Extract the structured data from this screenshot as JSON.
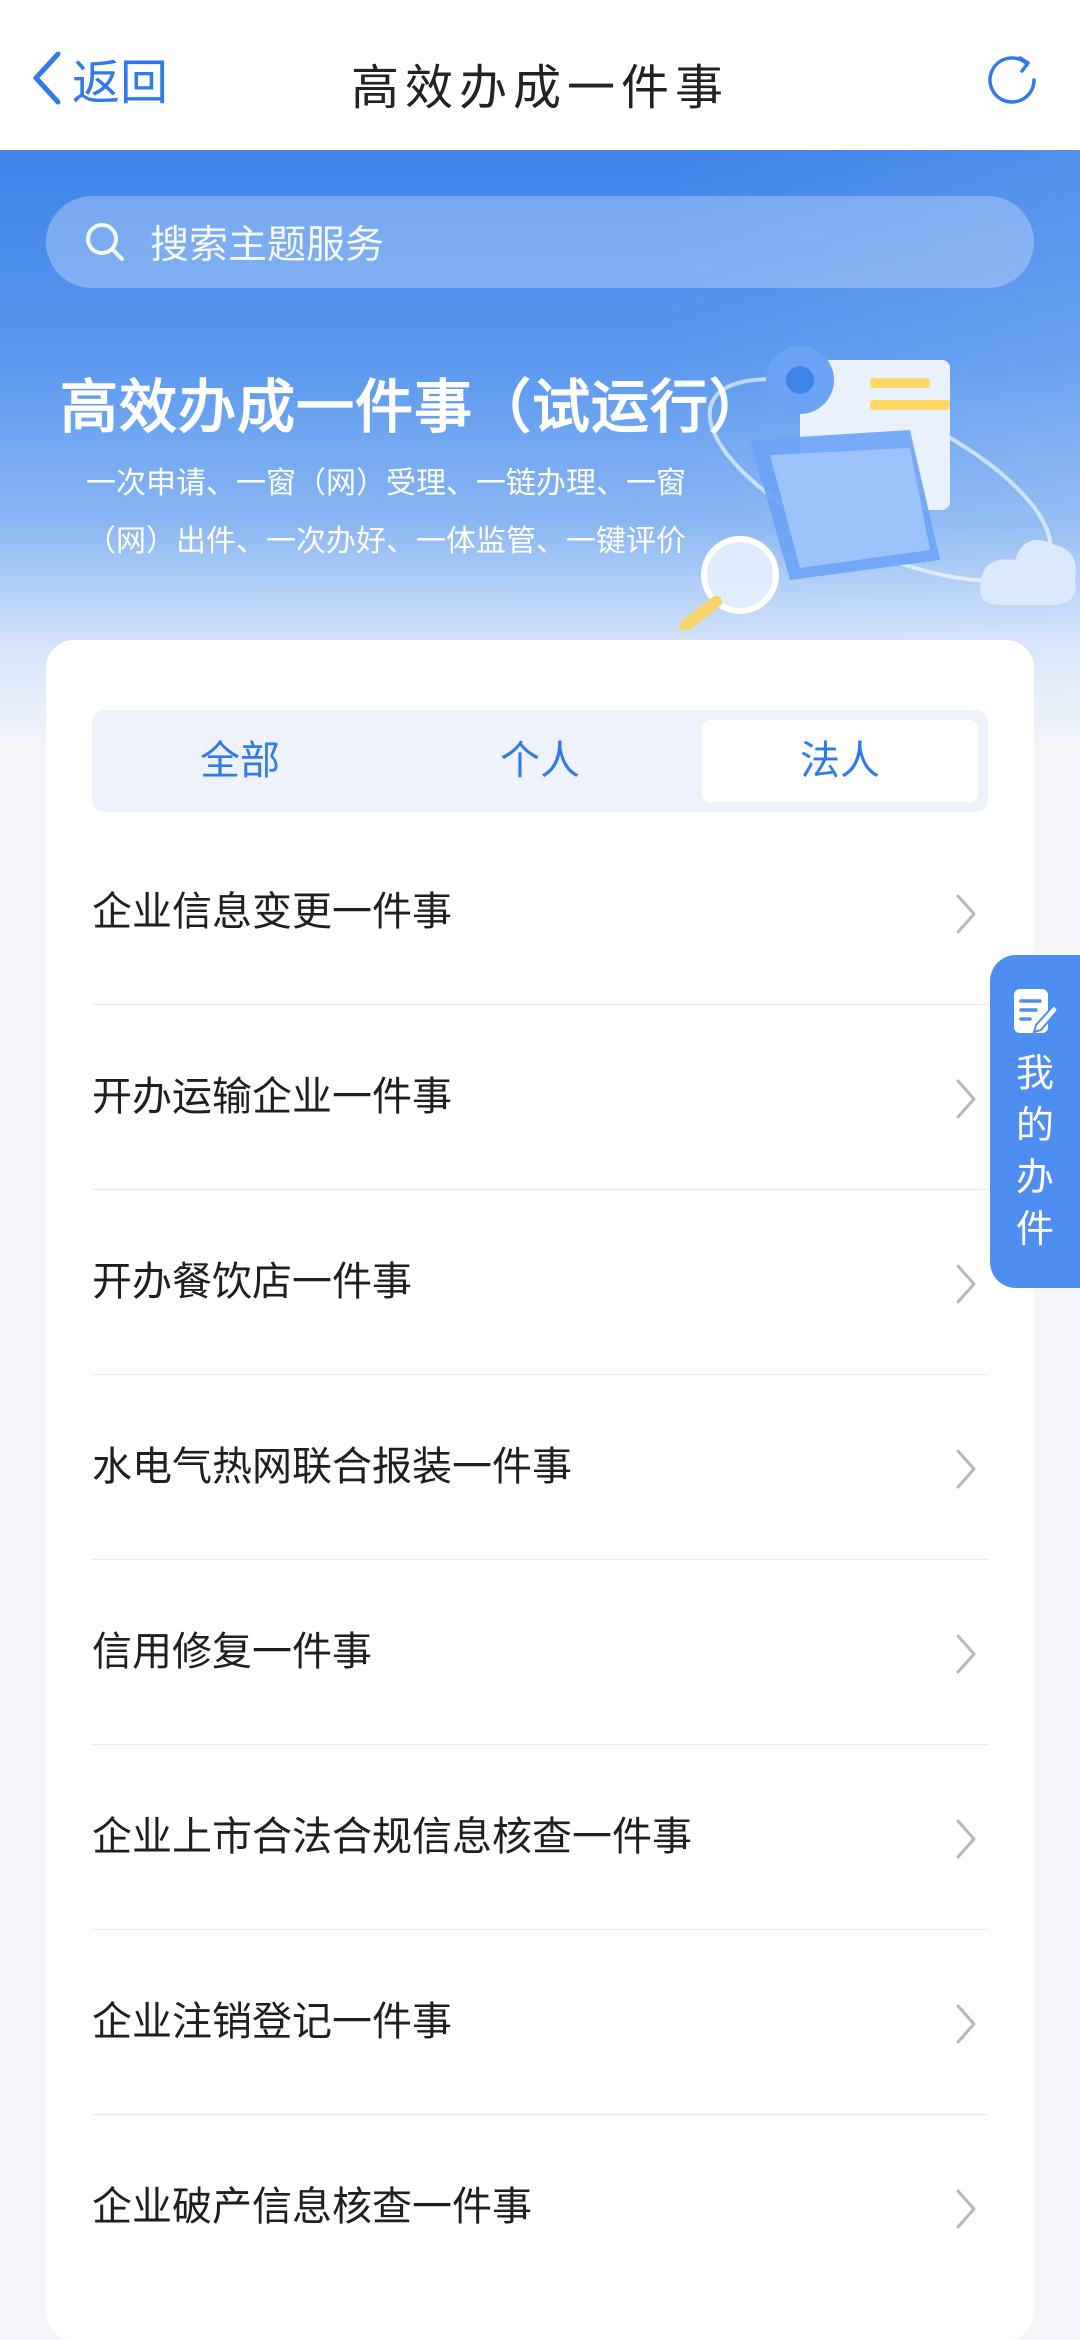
{
  "header": {
    "back_label": "返回",
    "title": "高效办成一件事"
  },
  "search": {
    "placeholder": "搜索主题服务"
  },
  "hero": {
    "title": "高效办成一件事（试运行）",
    "subtitle": "一次申请、一窗（网）受理、一链办理、一窗（网）出件、一次办好、一体监管、一键评价"
  },
  "tabs": [
    {
      "label": "全部",
      "active": false
    },
    {
      "label": "个人",
      "active": false
    },
    {
      "label": "法人",
      "active": true
    }
  ],
  "items": [
    {
      "label": "企业信息变更一件事"
    },
    {
      "label": "开办运输企业一件事"
    },
    {
      "label": "开办餐饮店一件事"
    },
    {
      "label": "水电气热网联合报装一件事"
    },
    {
      "label": "信用修复一件事"
    },
    {
      "label": "企业上市合法合规信息核查一件事"
    },
    {
      "label": "企业注销登记一件事"
    },
    {
      "label": "企业破产信息核查一件事"
    }
  ],
  "floating": {
    "label": "我的办件"
  },
  "colors": {
    "accent": "#2f7bea",
    "hero_top": "#3d83ea",
    "float_bg": "#4e8ef0"
  }
}
